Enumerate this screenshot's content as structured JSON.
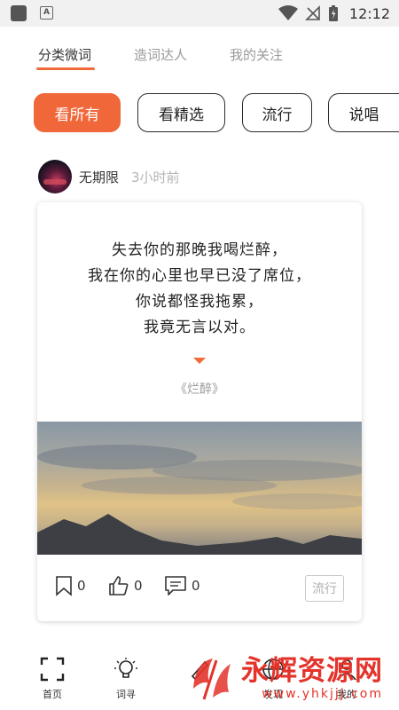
{
  "status_bar": {
    "time": "12:12",
    "icons": [
      "app-icon",
      "a-icon",
      "wifi-icon",
      "no-signal-icon",
      "battery-charging-icon"
    ]
  },
  "tabs": [
    {
      "label": "分类微词",
      "active": true
    },
    {
      "label": "造词达人",
      "active": false
    },
    {
      "label": "我的关注",
      "active": false
    }
  ],
  "filters": [
    {
      "label": "看所有",
      "active": true
    },
    {
      "label": "看精选",
      "active": false
    },
    {
      "label": "流行",
      "active": false
    },
    {
      "label": "说唱",
      "active": false
    }
  ],
  "post": {
    "author": "无期限",
    "time": "3小时前",
    "lyrics": [
      "失去你的那晚我喝烂醉，",
      "我在你的心里也早已没了席位，",
      "你说都怪我拖累，",
      "我竟无言以对。"
    ],
    "song": "《烂醉》",
    "bookmarks": "0",
    "likes": "0",
    "comments": "0",
    "tag": "流行"
  },
  "bottom_nav": [
    {
      "label": "首页",
      "icon": "scan-icon"
    },
    {
      "label": "词寻",
      "icon": "bulb-icon"
    },
    {
      "label": "",
      "icon": "pen-icon"
    },
    {
      "label": "发现",
      "icon": "globe-icon"
    },
    {
      "label": "我的",
      "icon": "user-icon"
    }
  ],
  "watermark": {
    "title": "永辉资源网",
    "url": "www.yhkjjj.com"
  },
  "colors": {
    "accent": "#f0673a",
    "watermark": "#e3332a"
  }
}
